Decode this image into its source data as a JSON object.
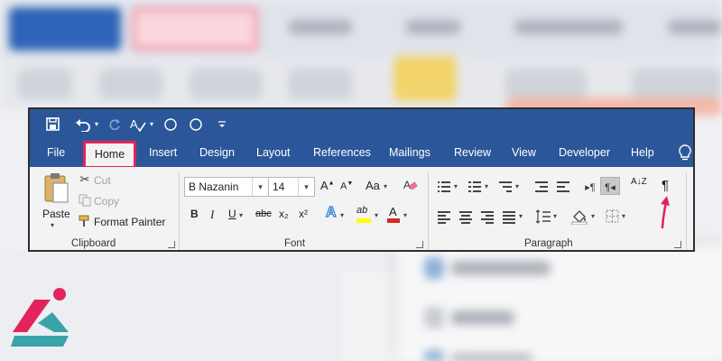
{
  "background": {
    "note_items": 3
  },
  "quick_access": {
    "save_icon": "save-icon",
    "undo_icon": "undo-icon",
    "redo_icon": "redo-icon",
    "spell_icon": "spelling-icon",
    "circle1": "circle-icon",
    "circle2": "circle-icon",
    "customize_icon": "customize-toolbar-icon"
  },
  "tabs": {
    "file": "File",
    "home": "Home",
    "insert": "Insert",
    "design": "Design",
    "layout": "Layout",
    "references": "References",
    "mailings": "Mailings",
    "review": "Review",
    "view": "View",
    "developer": "Developer",
    "help": "Help"
  },
  "clipboard": {
    "paste": "Paste",
    "cut": "Cut",
    "copy": "Copy",
    "format_painter": "Format Painter",
    "label": "Clipboard"
  },
  "font": {
    "name": "B Nazanin",
    "size": "14",
    "bold": "B",
    "italic": "I",
    "underline": "U",
    "strike": "abc",
    "subscript": "x₂",
    "superscript": "x²",
    "text_effects": "A",
    "highlight": "ab",
    "font_color": "A",
    "grow": "A",
    "shrink": "A",
    "change_case": "Aa",
    "label": "Font"
  },
  "paragraph": {
    "sort": "A↓Z",
    "pilcrow": "¶",
    "label": "Paragraph"
  },
  "colors": {
    "ribbon_blue": "#2b579a",
    "highlight_red": "#e3235b",
    "highlight_yellow": "#ffff00",
    "font_color_red": "#d22a2a",
    "text_effect_blue": "#2b7cd3"
  }
}
